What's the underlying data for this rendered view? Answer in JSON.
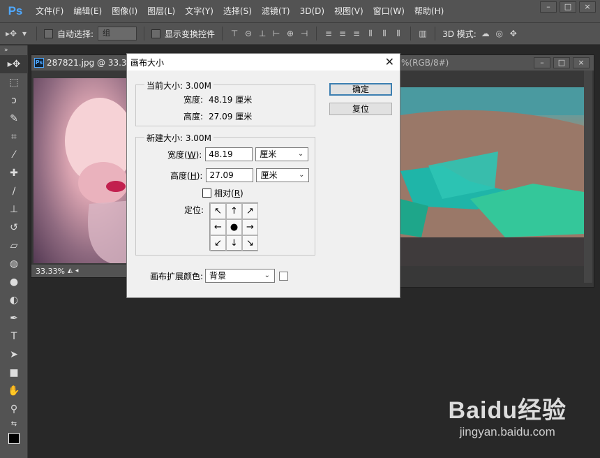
{
  "app": {
    "logo": "Ps"
  },
  "menu": [
    "文件(F)",
    "编辑(E)",
    "图像(I)",
    "图层(L)",
    "文字(Y)",
    "选择(S)",
    "滤镜(T)",
    "3D(D)",
    "视图(V)",
    "窗口(W)",
    "帮助(H)"
  ],
  "window_controls": [
    "–",
    "□",
    "×"
  ],
  "options_bar": {
    "auto_select_label": "自动选择:",
    "auto_select_value": "组",
    "show_transform_label": "显示变换控件",
    "mode_3d_label": "3D 模式:"
  },
  "doc1": {
    "title": "287821.jpg @ 33.3%",
    "zoom": "33.33%"
  },
  "doc2": {
    "title": "%(RGB/8#)"
  },
  "dialog": {
    "title": "画布大小",
    "current_size_legend": "当前大小: 3.00M",
    "current_width_label": "宽度:",
    "current_width_value": "48.19 厘米",
    "current_height_label": "高度:",
    "current_height_value": "27.09 厘米",
    "new_size_legend": "新建大小: 3.00M",
    "width_label_pre": "宽度(",
    "width_label_key": "W",
    "width_label_post": "):",
    "width_value": "48.19",
    "width_unit": "厘米",
    "height_label_pre": "高度(",
    "height_label_key": "H",
    "height_label_post": "):",
    "height_value": "27.09",
    "height_unit": "厘米",
    "relative_label_pre": "相对(",
    "relative_label_key": "R",
    "relative_label_post": ")",
    "anchor_label": "定位:",
    "anchor_arrows": [
      "↖",
      "↑",
      "↗",
      "←",
      "●",
      "→",
      "↙",
      "↓",
      "↘"
    ],
    "extension_color_label": "画布扩展颜色:",
    "extension_color_value": "背景",
    "ok_button": "确定",
    "reset_button": "复位"
  },
  "watermark": {
    "logo": "Baidu经验",
    "url": "jingyan.baidu.com"
  }
}
